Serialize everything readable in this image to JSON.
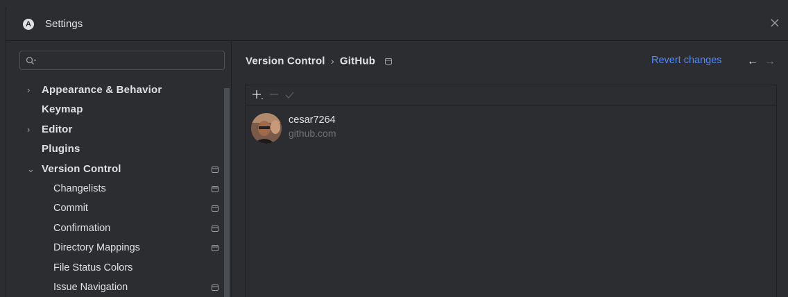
{
  "window": {
    "title": "Settings"
  },
  "search": {
    "placeholder": "",
    "value": ""
  },
  "tree": {
    "items": [
      {
        "label": "Appearance & Behavior",
        "chevron": "›",
        "project_icon": false
      },
      {
        "label": "Keymap",
        "chevron": "",
        "project_icon": false
      },
      {
        "label": "Editor",
        "chevron": "›",
        "project_icon": false
      },
      {
        "label": "Plugins",
        "chevron": "",
        "project_icon": false
      },
      {
        "label": "Version Control",
        "chevron": "⌄",
        "project_icon": true
      },
      {
        "label": "Changelists",
        "project_icon": true
      },
      {
        "label": "Commit",
        "project_icon": true
      },
      {
        "label": "Confirmation",
        "project_icon": true
      },
      {
        "label": "Directory Mappings",
        "project_icon": true
      },
      {
        "label": "File Status Colors",
        "project_icon": false
      },
      {
        "label": "Issue Navigation",
        "project_icon": true
      }
    ]
  },
  "header": {
    "breadcrumb": [
      "Version Control",
      "GitHub"
    ],
    "separator": "›",
    "revert_label": "Revert changes",
    "back_glyph": "←",
    "forward_glyph": "→"
  },
  "toolbar": {
    "add_icon": "plus-icon",
    "remove_icon": "minus-icon",
    "default_icon": "check-icon"
  },
  "account": {
    "name": "cesar7264",
    "server": "github.com"
  },
  "colors": {
    "accent": "#548af7",
    "text": "#dfe1e5",
    "muted": "#6f737a",
    "background": "#2b2d30"
  }
}
